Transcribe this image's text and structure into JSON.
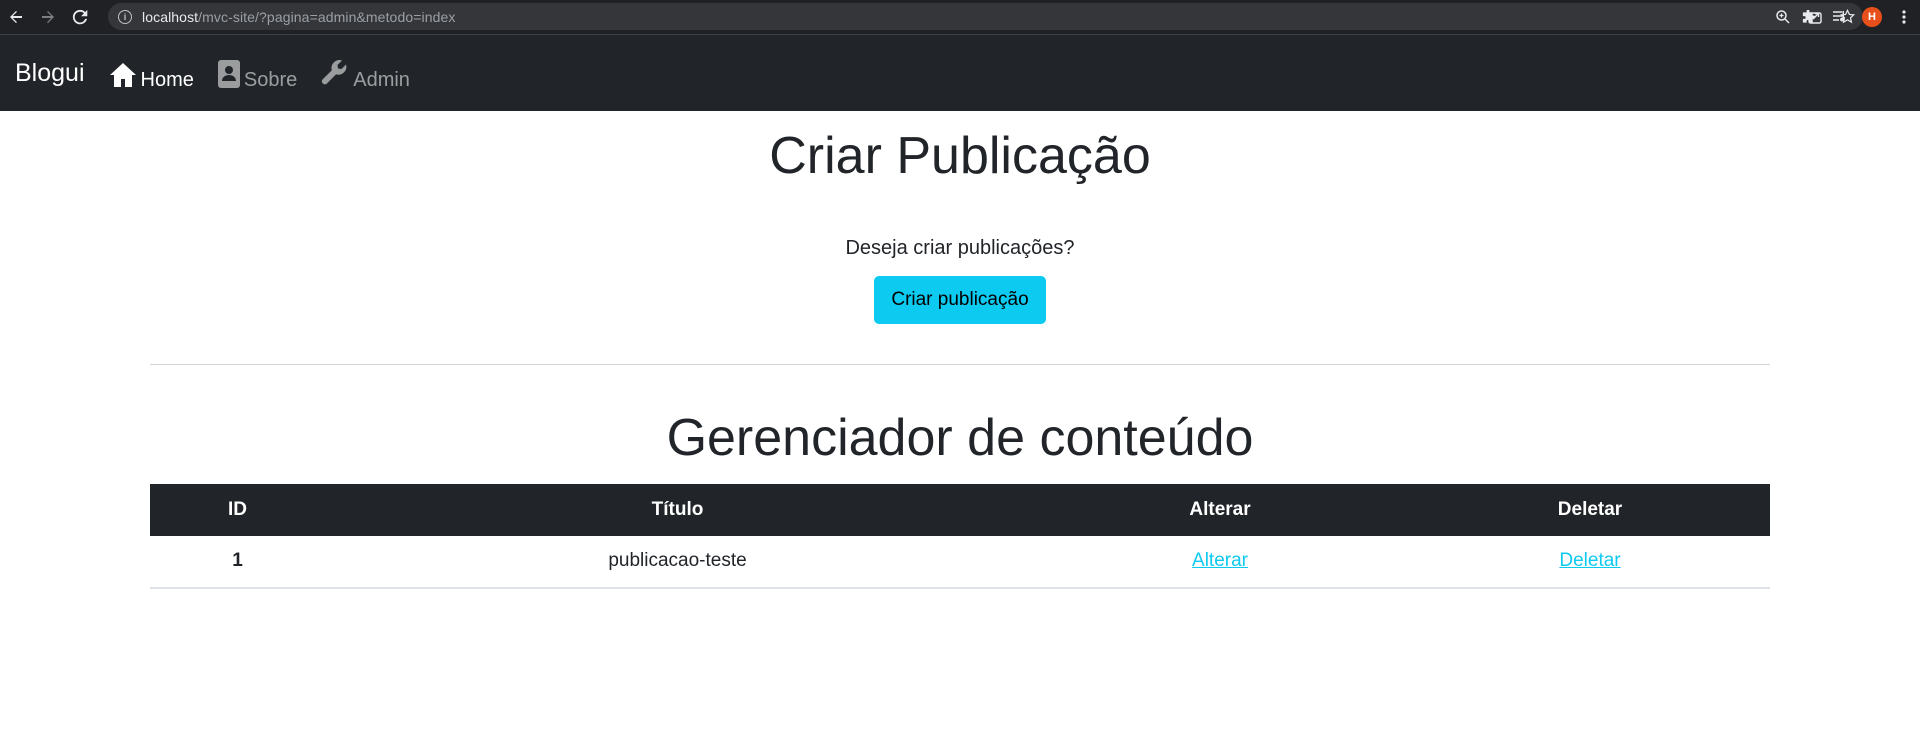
{
  "browser": {
    "url_host": "localhost",
    "url_path": "/mvc-site/?pagina=admin&metodo=index",
    "avatar_letter": "H",
    "avatar_color": "#e8501b",
    "icons": [
      "back-arrow-icon",
      "forward-arrow-icon",
      "reload-icon",
      "site-info-icon",
      "zoom-icon",
      "share-icon",
      "bookmark-star-icon",
      "extensions-icon",
      "reading-list-icon",
      "menu-dots-icon"
    ]
  },
  "navbar": {
    "brand": "Blogui",
    "items": [
      {
        "label": "Home",
        "icon": "home-icon",
        "active": true
      },
      {
        "label": "Sobre",
        "icon": "contact-card-icon",
        "active": false
      },
      {
        "label": "Admin",
        "icon": "wrench-icon",
        "active": false
      }
    ]
  },
  "main": {
    "create_title": "Criar Publicação",
    "create_prompt": "Deseja criar publicações?",
    "create_button": "Criar publicação",
    "manager_title": "Gerenciador de conteúdo",
    "table": {
      "headers": [
        "ID",
        "Título",
        "Alterar",
        "Deletar"
      ],
      "rows": [
        {
          "id": "1",
          "titulo": "publicacao-teste",
          "alterar": "Alterar",
          "deletar": "Deletar"
        }
      ]
    }
  },
  "colors": {
    "navbar_bg": "#212529",
    "info_button": "#0dcaf0",
    "link": "#0dcaf0"
  }
}
